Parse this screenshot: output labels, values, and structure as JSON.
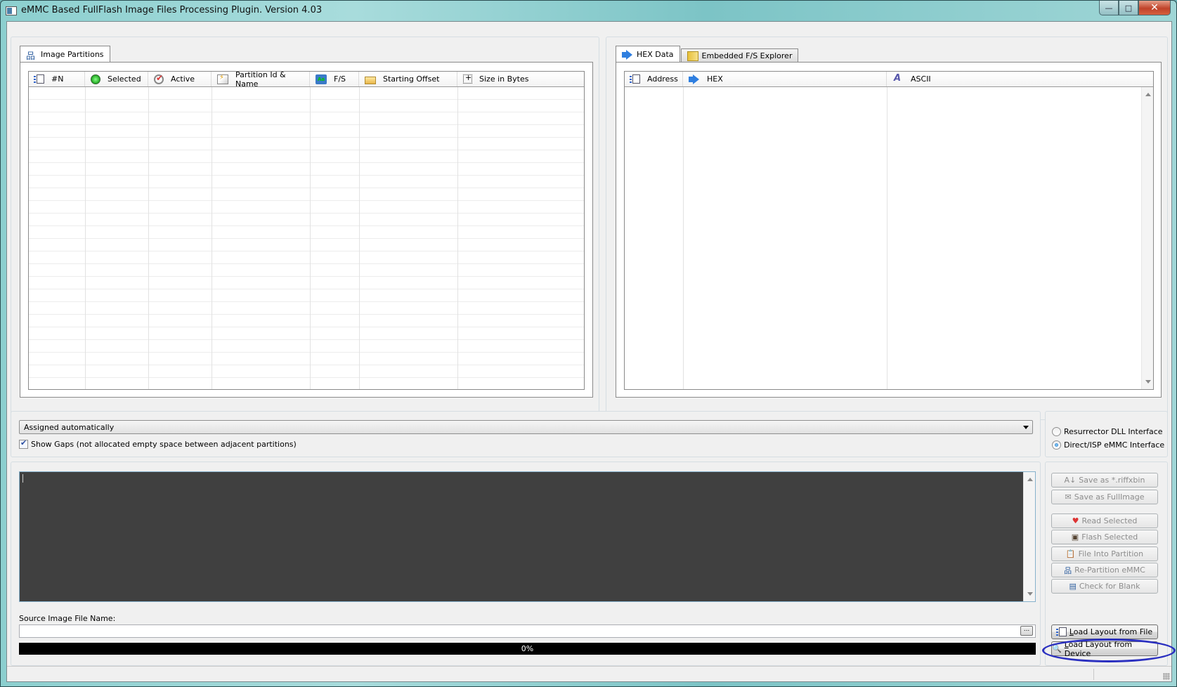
{
  "window": {
    "title": "eMMC Based FullFlash Image Files Processing Plugin. Version 4.03",
    "controls": {
      "minimize": "—",
      "maximize": "□",
      "close": "✕"
    }
  },
  "left_panel": {
    "tab_label": "Image Partitions",
    "tab_icon": "partition-tree-icon",
    "columns": [
      {
        "label": "#N",
        "icon": "numbered-list-icon"
      },
      {
        "label": "Selected",
        "icon": "green-arrow-icon"
      },
      {
        "label": "Active",
        "icon": "checkmark-icon"
      },
      {
        "label": "Partition Id & Name",
        "icon": "note-icon"
      },
      {
        "label": "F/S",
        "icon": "filesystem-icon"
      },
      {
        "label": "Starting Offset",
        "icon": "folder-icon"
      },
      {
        "label": "Size in Bytes",
        "icon": "size-icon"
      }
    ],
    "rows": []
  },
  "right_panel": {
    "tabs": [
      {
        "label": "HEX Data",
        "icon": "blue-arrow-icon",
        "active": true
      },
      {
        "label": "Embedded F/S Explorer",
        "icon": "yellow-book-icon",
        "active": false
      }
    ],
    "columns": [
      {
        "label": "Address",
        "icon": "numbered-list-icon"
      },
      {
        "label": "HEX",
        "icon": "blue-arrow-icon"
      },
      {
        "label": "ASCII",
        "icon": "ascii-icon"
      }
    ],
    "rows": []
  },
  "options": {
    "layout_combo_value": "Assigned automatically",
    "show_gaps_label": "Show Gaps (not allocated empty space between adjacent partitions)",
    "show_gaps_checked": true,
    "interface_options": [
      {
        "label": "Resurrector DLL Interface",
        "selected": false
      },
      {
        "label": "Direct/ISP eMMC Interface",
        "selected": true
      }
    ]
  },
  "log": {
    "text": ""
  },
  "source": {
    "label": "Source Image File Name:",
    "value": "",
    "browse_label": "..."
  },
  "progress": {
    "text": "0%",
    "value_percent": 0
  },
  "actions": [
    {
      "label": "Save as *.riffxbin",
      "icon": "sort-az-icon",
      "enabled": false
    },
    {
      "label": "Save as FullImage",
      "icon": "envelope-icon",
      "enabled": false
    },
    {
      "label": "Read Selected",
      "icon": "heart-download-icon",
      "enabled": false
    },
    {
      "label": "Flash Selected",
      "icon": "chip-icon",
      "enabled": false
    },
    {
      "label": "File Into Partition",
      "icon": "clipboard-link-icon",
      "enabled": false
    },
    {
      "label": "Re-Partition eMMC",
      "icon": "partition-tree-icon",
      "enabled": false
    },
    {
      "label": "Check for Blank",
      "icon": "document-icon",
      "enabled": false
    },
    {
      "label_hotkey": "L",
      "label_rest": "oad Layout from File",
      "icon": "numbered-list-icon",
      "enabled": true
    },
    {
      "label_hotkey": "L",
      "label_rest": "oad Layout from Device",
      "icon": "device-search-icon",
      "enabled": true
    }
  ],
  "annotation": {
    "color": "#2a2fc0",
    "target": "Load Layout from Device"
  }
}
